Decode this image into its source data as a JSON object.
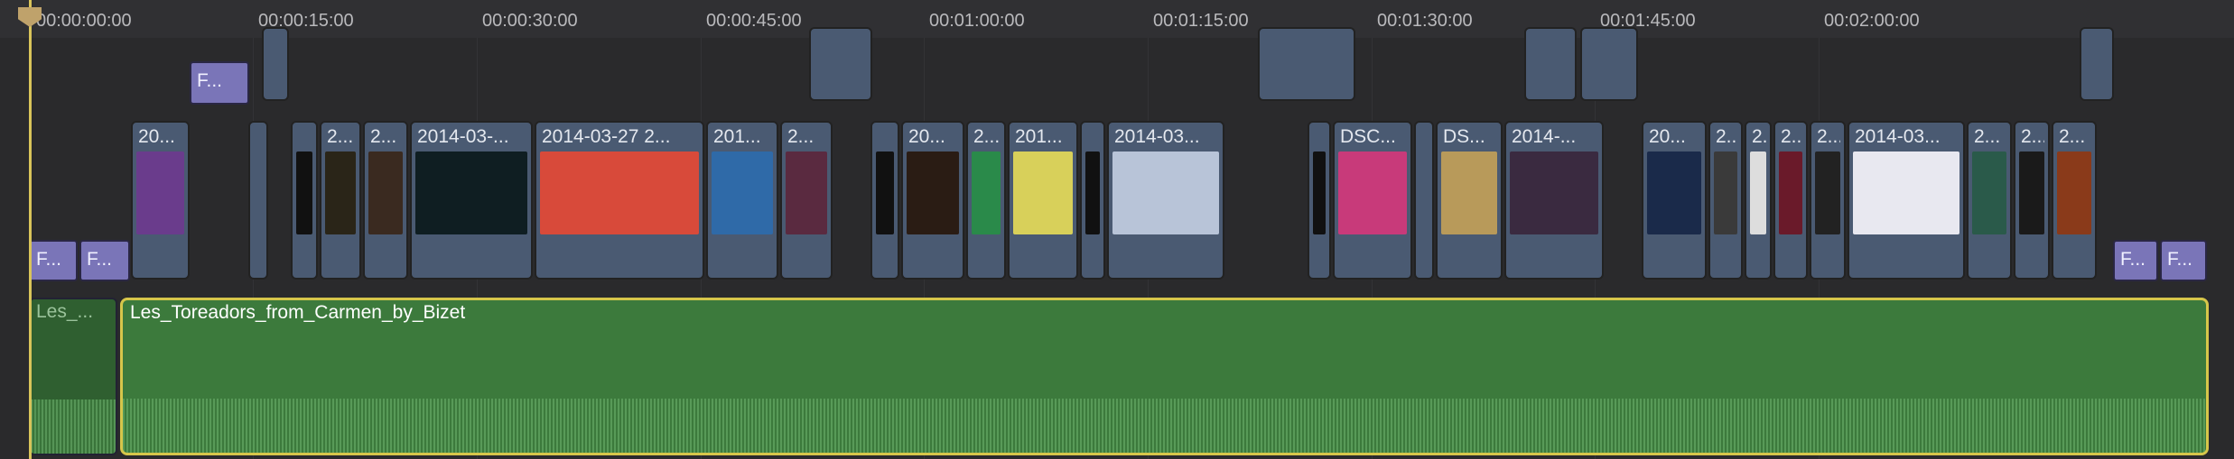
{
  "ruler": {
    "timecodes": [
      "00:00:00:00",
      "00:00:15:00",
      "00:00:30:00",
      "00:00:45:00",
      "00:01:00:00",
      "00:01:15:00",
      "00:01:30:00",
      "00:01:45:00",
      "00:02:00:00"
    ]
  },
  "colors": {
    "background": "#2a2a2c",
    "video_clip": "#4a5a72",
    "title_clip": "#7a75b8",
    "audio_clip": "#3c7a3c",
    "selection": "#d6c64a",
    "playhead": "#d9c45a"
  },
  "video_clips": [
    {
      "label": "20..."
    },
    {
      "label": ""
    },
    {
      "label": ""
    },
    {
      "label": "2..."
    },
    {
      "label": "2..."
    },
    {
      "label": "2014-03-..."
    },
    {
      "label": "2014-03-27 2..."
    },
    {
      "label": "201..."
    },
    {
      "label": "2..."
    },
    {
      "label": ""
    },
    {
      "label": "20..."
    },
    {
      "label": "2..."
    },
    {
      "label": "201..."
    },
    {
      "label": ""
    },
    {
      "label": "2014-03..."
    },
    {
      "label": ""
    },
    {
      "label": "DSC..."
    },
    {
      "label": ""
    },
    {
      "label": "DS..."
    },
    {
      "label": "2014-..."
    },
    {
      "label": "20..."
    },
    {
      "label": "2..."
    },
    {
      "label": "2..."
    },
    {
      "label": "2..."
    },
    {
      "label": "2014-03..."
    },
    {
      "label": "2..."
    },
    {
      "label": "2..."
    },
    {
      "label": "2..."
    }
  ],
  "title_clips": [
    {
      "label": "F..."
    },
    {
      "label": "F..."
    },
    {
      "label": "F..."
    },
    {
      "label": "F..."
    },
    {
      "label": "F..."
    }
  ],
  "audio_clips": {
    "main_label": "Les_Toreadors_from_Carmen_by_Bizet",
    "small_label": "Les_..."
  }
}
